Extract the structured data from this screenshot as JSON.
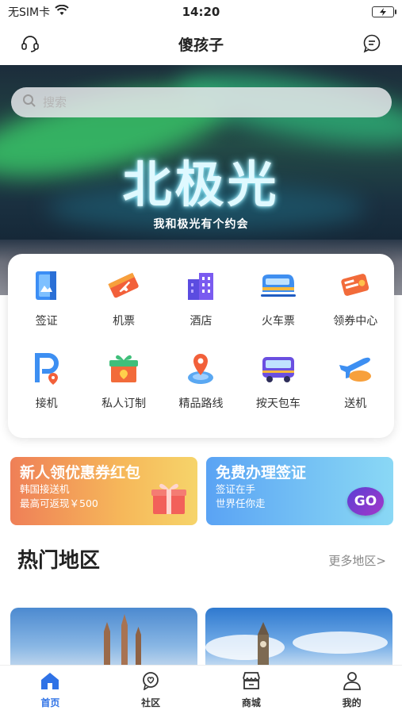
{
  "status_bar": {
    "carrier": "无SIM卡",
    "time": "14:20"
  },
  "header": {
    "title": "傻孩子",
    "left_icon": "headset-icon",
    "right_icon": "chat-bubble-icon"
  },
  "search": {
    "placeholder": "搜索"
  },
  "banner": {
    "title": "北极光",
    "subtitle": "我和极光有个约会"
  },
  "services": [
    {
      "label": "签证",
      "icon": "visa-icon"
    },
    {
      "label": "机票",
      "icon": "air-ticket-icon"
    },
    {
      "label": "酒店",
      "icon": "hotel-icon"
    },
    {
      "label": "火车票",
      "icon": "train-icon"
    },
    {
      "label": "领券中心",
      "icon": "coupon-icon"
    },
    {
      "label": "接机",
      "icon": "pickup-icon"
    },
    {
      "label": "私人订制",
      "icon": "gift-box-icon"
    },
    {
      "label": "精品路线",
      "icon": "route-pin-icon"
    },
    {
      "label": "按天包车",
      "icon": "bus-icon"
    },
    {
      "label": "送机",
      "icon": "airplane-icon"
    }
  ],
  "promos": {
    "left": {
      "title": "新人领优惠券红包",
      "line1": "韩国接送机",
      "line2": "最高可返现￥500"
    },
    "right": {
      "title": "免费办理签证",
      "line1": "签证在手",
      "line2": "世界任你走",
      "badge": "GO"
    }
  },
  "hot_section": {
    "title": "热门地区",
    "more": "更多地区>"
  },
  "tabbar": [
    {
      "label": "首页",
      "icon": "home-icon",
      "active": true
    },
    {
      "label": "社区",
      "icon": "community-icon",
      "active": false
    },
    {
      "label": "商城",
      "icon": "store-icon",
      "active": false
    },
    {
      "label": "我的",
      "icon": "profile-icon",
      "active": false
    }
  ],
  "colors": {
    "accent": "#2f72e6",
    "promo_orange": "#ef7f57",
    "promo_blue": "#5aa3f4"
  }
}
